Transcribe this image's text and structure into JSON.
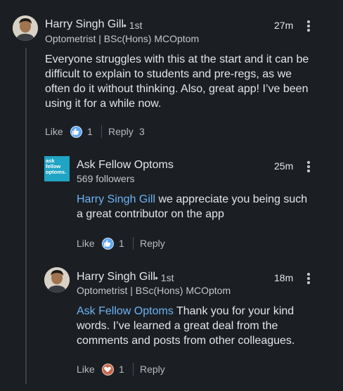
{
  "comments": [
    {
      "name": "Harry Singh Gill",
      "degree": "• 1st",
      "headline": "Optometrist | BSc(Hons) MCOptom",
      "time": "27m",
      "text": "Everyone struggles with this at the start and it can be difficult to explain to students and pre-regs, as we often do it without thinking. Also, great app! I’ve been using it for a while now.",
      "like_label": "Like",
      "reaction_count": "1",
      "reply_label": "Reply",
      "reply_count": "3"
    }
  ],
  "replies": [
    {
      "name": "Ask Fellow Optoms",
      "logo_text": "ask fellow optoms.",
      "followers": "569 followers",
      "time": "25m",
      "mention": "Harry Singh Gill",
      "text": " we appreciate you being such a great contributor on the app",
      "like_label": "Like",
      "reaction_count": "1",
      "reply_label": "Reply"
    },
    {
      "name": "Harry Singh Gill",
      "degree": "• 1st",
      "headline": "Optometrist | BSc(Hons) MCOptom",
      "time": "18m",
      "mention": "Ask Fellow Optoms",
      "text": " Thank you for your kind words. I’ve learned a great deal from the comments and posts from other colleagues.",
      "like_label": "Like",
      "reaction_count": "1",
      "reply_label": "Reply"
    }
  ],
  "icons": {
    "like": "thumbs-up-icon",
    "love": "heart-icon",
    "more": "more-vertical-icon"
  },
  "colors": {
    "background": "#1b1f23",
    "mention": "#6fb3f5",
    "like_reaction": "#5fa6f2",
    "love_reaction": "#c6674e",
    "logo": "#1fa4c4"
  }
}
